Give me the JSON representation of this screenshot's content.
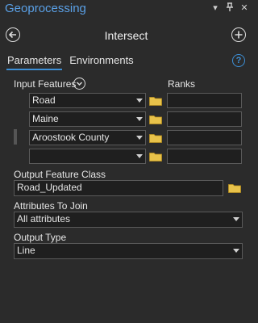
{
  "window": {
    "title": "Geoprocessing",
    "controls": [
      "▾",
      "ㅁ",
      "✕"
    ]
  },
  "tool": {
    "title": "Intersect"
  },
  "tabs": [
    {
      "label": "Parameters",
      "active": true
    },
    {
      "label": "Environments",
      "active": false
    }
  ],
  "input_features": {
    "label": "Input Features",
    "ranks_label": "Ranks",
    "rows": [
      {
        "value": "Road",
        "rank": ""
      },
      {
        "value": "Maine",
        "rank": ""
      },
      {
        "value": "Aroostook County",
        "rank": ""
      },
      {
        "value": "",
        "rank": ""
      }
    ]
  },
  "output_feature_class": {
    "label": "Output Feature Class",
    "value": "Road_Updated"
  },
  "attributes_to_join": {
    "label": "Attributes To Join",
    "value": "All attributes"
  },
  "output_type": {
    "label": "Output Type",
    "value": "Line"
  },
  "colors": {
    "accent": "#3d8fd6",
    "folder": "#e8c24a"
  }
}
